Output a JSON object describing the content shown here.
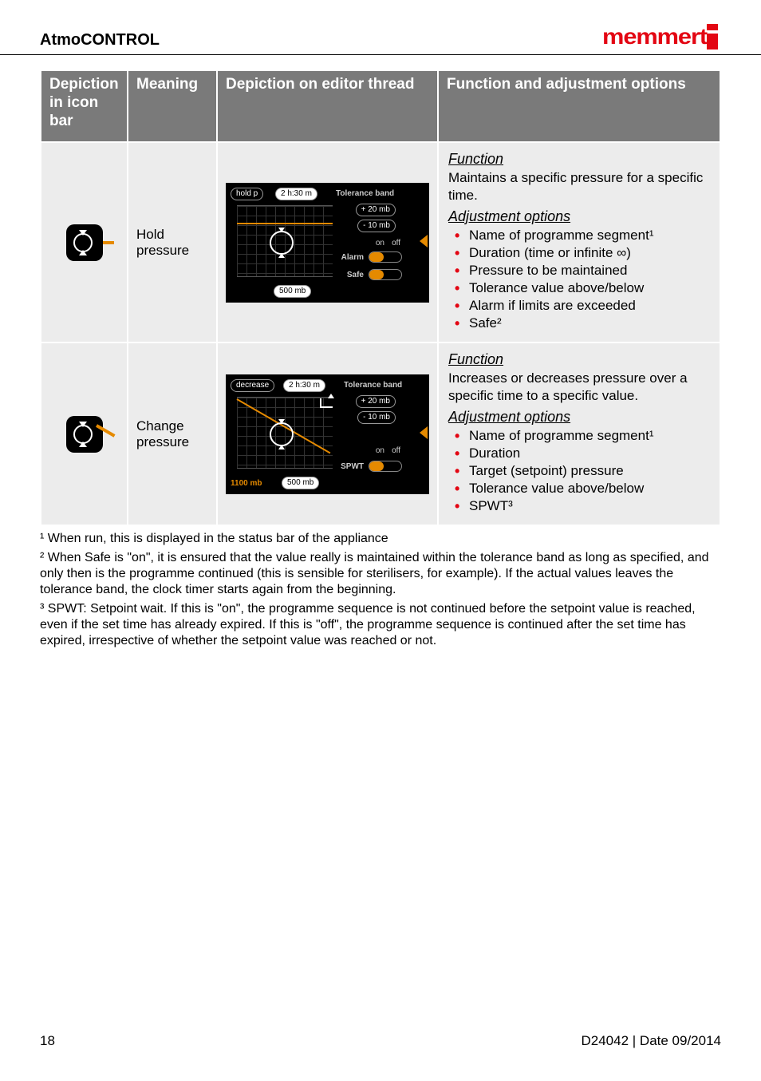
{
  "header": {
    "title": "AtmoCONTROL",
    "brand": "memmert"
  },
  "table": {
    "headers": {
      "col1": "Depiction in icon bar",
      "col2": "Meaning",
      "col3": "Depiction on editor thread",
      "col4": "Function and adjustment options"
    },
    "rows": [
      {
        "meaning": "Hold pressure",
        "panel": {
          "name": "hold p",
          "time": "2 h:30 m",
          "band_label": "Tolerance band",
          "plus": "+ 20 mb",
          "minus": "- 10 mb",
          "onoff_on": "on",
          "onoff_off": "off",
          "alarm": "Alarm",
          "safe": "Safe",
          "value": "500 mb"
        },
        "func_head": "Function",
        "func_text": "Maintains a specific pressure for a specific time.",
        "adj_head": "Adjustment options",
        "bullets": [
          "Name of programme segment¹",
          "Duration (time or infinite ∞)",
          "Pressure to be maintained",
          "Tolerance value above/below",
          "Alarm if limits are exceeded",
          "Safe²"
        ]
      },
      {
        "meaning": "Change pressure",
        "panel": {
          "name": "decrease",
          "time": "2 h:30 m",
          "band_label": "Tolerance band",
          "plus": "+ 20 mb",
          "minus": "- 10 mb",
          "onoff_on": "on",
          "onoff_off": "off",
          "spwt": "SPWT",
          "start": "1100 mb",
          "value": "500 mb"
        },
        "func_head": "Function",
        "func_text": "Increases or decreases pressure over a specific time to a specific value.",
        "adj_head": "Adjustment options",
        "bullets": [
          "Name of programme segment¹",
          "Duration",
          "Target (setpoint) pressure",
          "Tolerance value above/below",
          "SPWT³"
        ]
      }
    ]
  },
  "footnotes": {
    "f1": "¹ When run, this is displayed in the status bar of the appliance",
    "f2": "² When Safe is \"on\", it is ensured that the value really is maintained within the tolerance band as long as specified, and only then is the programme continued (this is sensible for sterilisers, for example). If the actual values leaves the tolerance band, the clock timer starts again from the beginning.",
    "f3": "³ SPWT: Setpoint wait. If this is \"on\", the programme sequence is not continued before the setpoint value is reached, even if the set time has already expired. If this is \"off\", the programme sequence is continued after the set time has expired, irrespective of whether the setpoint value was reached or not."
  },
  "footer": {
    "page": "18",
    "doc": "D24042 | Date 09/2014"
  }
}
